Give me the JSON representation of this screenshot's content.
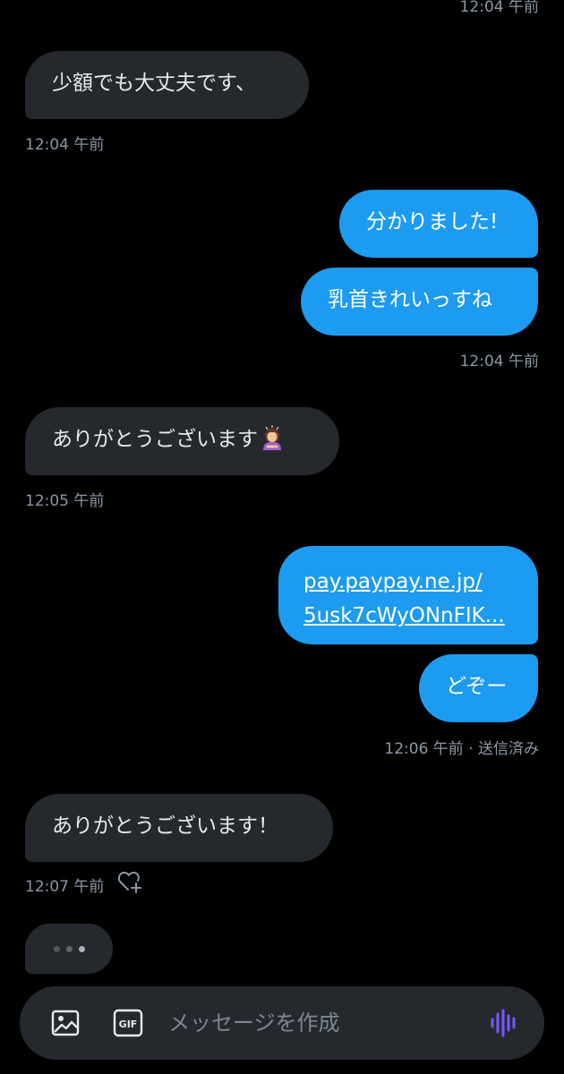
{
  "colors": {
    "background": "#000000",
    "incoming_bubble": "#25292e",
    "outgoing_bubble": "#1d9bf0",
    "timestamp": "#8b98a5",
    "voice_accent": "#7856ff"
  },
  "thread": {
    "top_partial_timestamp": "12:04 午前",
    "messages": [
      {
        "direction": "incoming",
        "text": "少額でも大丈夫です、",
        "timestamp": "12:04 午前"
      },
      {
        "direction": "outgoing",
        "text": "分かりました!"
      },
      {
        "direction": "outgoing",
        "text": "乳首きれいっすね",
        "timestamp": "12:04 午前"
      },
      {
        "direction": "incoming",
        "text": "ありがとうございます",
        "emoji": "person-bowing-emoji",
        "timestamp": "12:05 午前"
      },
      {
        "direction": "outgoing",
        "link_line1": "pay.paypay.ne.jp/",
        "link_line2": "5usk7cWyONnFIK..."
      },
      {
        "direction": "outgoing",
        "text": "どぞー",
        "timestamp": "12:06 午前 · 送信済み"
      },
      {
        "direction": "incoming",
        "text": "ありがとうございます！",
        "timestamp": "12:07 午前",
        "reaction_icon": "heart-plus-icon"
      }
    ],
    "typing_indicator": "typing-dots"
  },
  "composer": {
    "placeholder": "メッセージを作成",
    "image_icon": "image-icon",
    "gif_label": "GIF",
    "voice_icon": "voice-waveform-icon"
  }
}
